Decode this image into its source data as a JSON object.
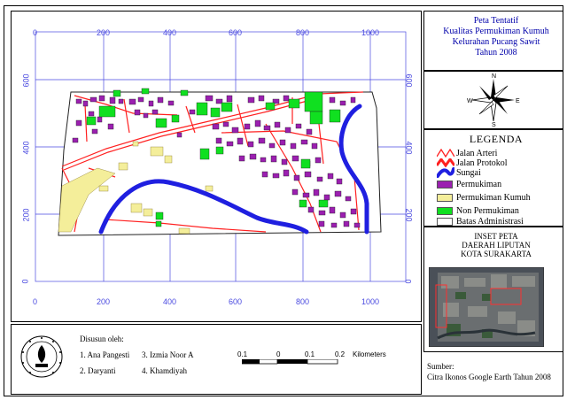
{
  "map": {
    "title_lines": [
      "Peta Tentatif",
      "Kualitas Permukiman Kumuh",
      "Kelurahan Pucang Sawit",
      "Tahun 2008"
    ],
    "grid_x_labels": [
      "0",
      "200",
      "400",
      "600",
      "800",
      "1000"
    ],
    "grid_y_labels": [
      "600",
      "400",
      "200",
      "0"
    ],
    "compass_labels": {
      "n": "N",
      "s": "S",
      "e": "E",
      "w": "W"
    }
  },
  "legend": {
    "title": "LEGENDA",
    "items": [
      {
        "label": "Jalan Arteri",
        "color": "#ff2020",
        "kind": "line"
      },
      {
        "label": "Jalan Protokol",
        "color": "#ff2020",
        "kind": "double-line"
      },
      {
        "label": "Sungai",
        "color": "#1f1fe0",
        "kind": "thick-line"
      },
      {
        "label": "Permukiman",
        "color": "#9b1fb0",
        "kind": "fill"
      },
      {
        "label": "Permukiman Kumuh",
        "color": "#f4ee9a",
        "kind": "fill"
      },
      {
        "label": "Non Permukiman",
        "color": "#10e020",
        "kind": "fill"
      },
      {
        "label": "Batas Administrasi",
        "color": "#ffffff",
        "kind": "fill"
      }
    ]
  },
  "inset": {
    "title_lines": [
      "INSET PETA",
      "DAERAH LIPUTAN",
      "KOTA SURAKARTA"
    ]
  },
  "credits": {
    "heading": "Disusun oleh:",
    "names": [
      "1. Ana Pangesti",
      "2. Daryanti",
      "3. Izmia Noor A",
      "4. Khamdiyah"
    ]
  },
  "scale": {
    "labels": [
      "0.1",
      "0",
      "0.1",
      "0.2"
    ],
    "unit": "Kilometers"
  },
  "source": {
    "heading": "Sumber:",
    "text": "Citra Ikonos Google Earth Tahun 2008"
  },
  "colors": {
    "road": "#ff2020",
    "river": "#1f1fe0",
    "settlement": "#9b1fb0",
    "slum": "#f4ee9a",
    "non_settlement": "#10e020",
    "grid": "#4a4ae0"
  }
}
